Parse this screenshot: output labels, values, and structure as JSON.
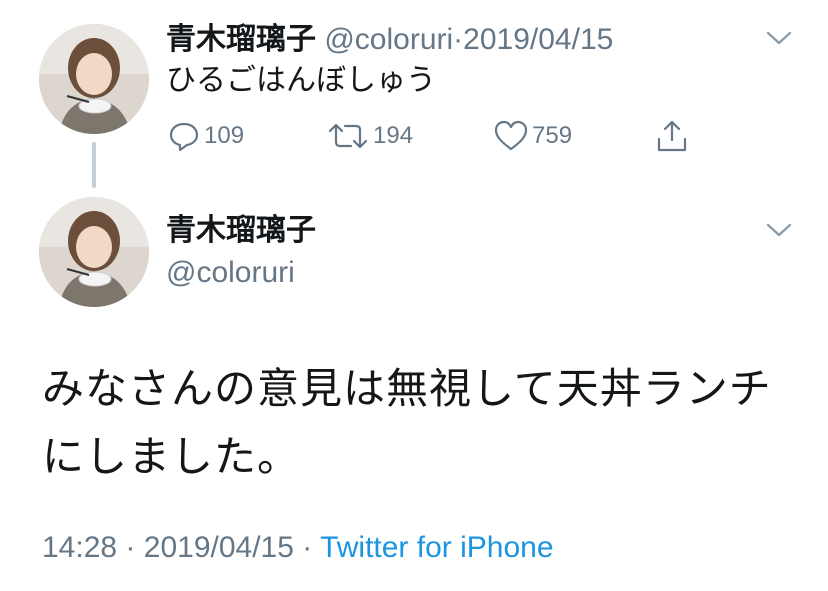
{
  "tweet1": {
    "display_name": "青木瑠璃子",
    "handle": "@coloruri",
    "separator": "·",
    "date": "2019/04/15",
    "text": "ひるごはんぼしゅう",
    "replies": "109",
    "retweets": "194",
    "likes": "759"
  },
  "tweet2": {
    "display_name": "青木瑠璃子",
    "handle": "@coloruri",
    "text": "みなさんの意見は無視して天丼ランチにしました。",
    "time": "14:28",
    "separator": "·",
    "date": "2019/04/15",
    "source_separator": "·",
    "source": "Twitter for iPhone"
  },
  "colors": {
    "text": "#14171a",
    "muted": "#657786",
    "link": "#1b95e0",
    "thread_line": "#c4cfd6"
  },
  "icons": [
    "reply-icon",
    "retweet-icon",
    "like-icon",
    "share-icon",
    "chevron-down-icon"
  ]
}
